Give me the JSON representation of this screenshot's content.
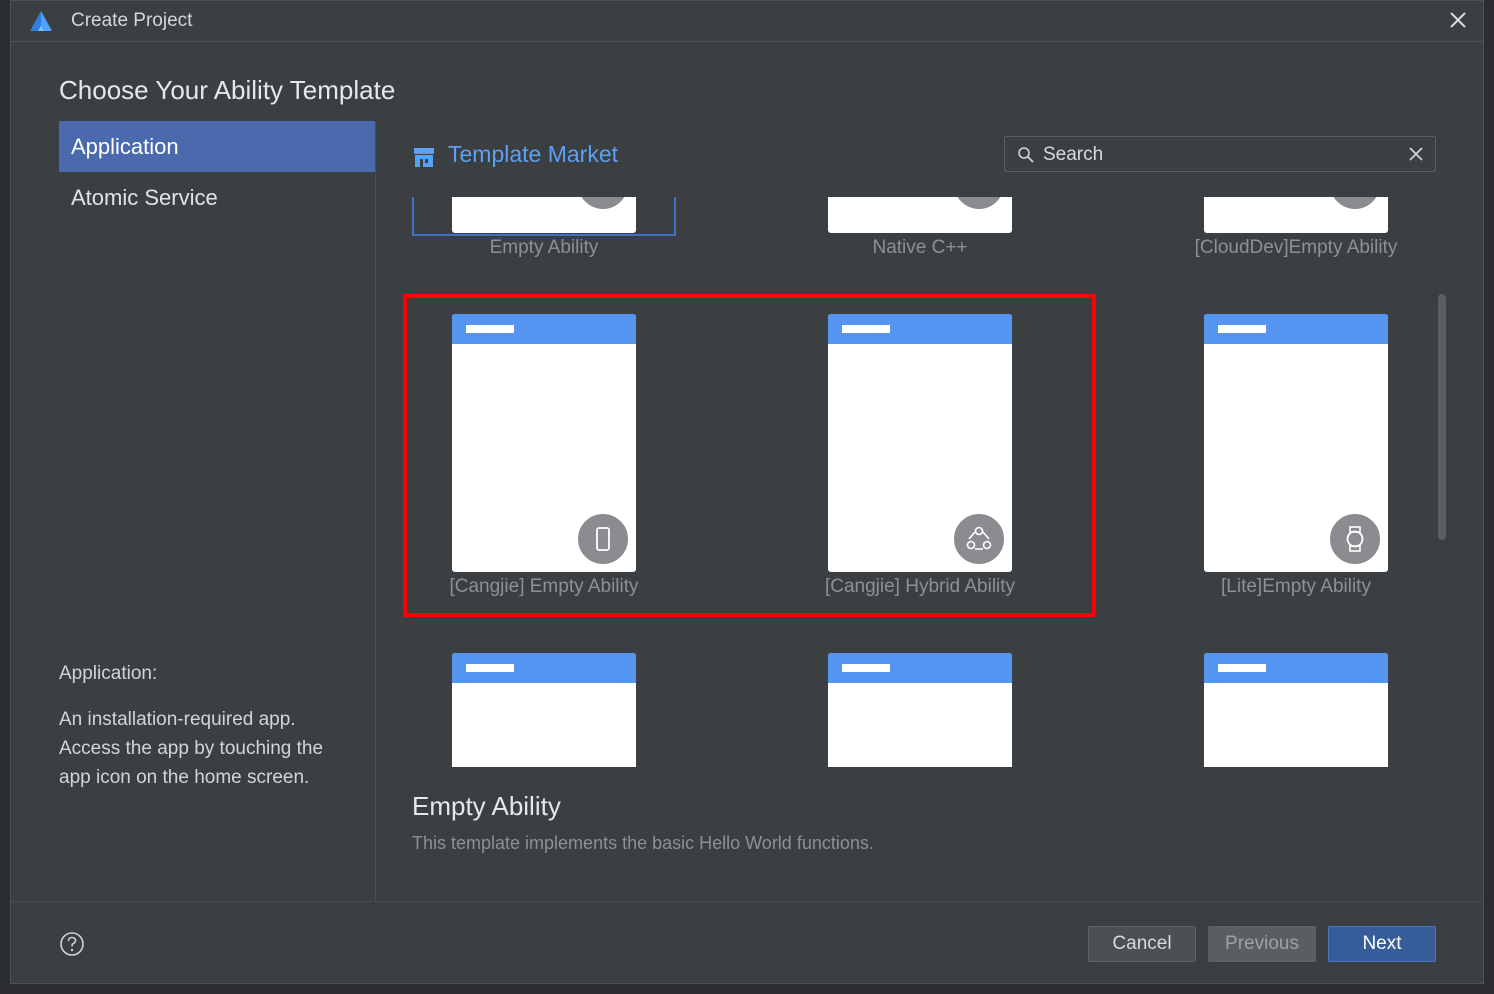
{
  "window": {
    "title": "Create Project"
  },
  "heading": "Choose Your Ability Template",
  "sidebar": {
    "items": [
      {
        "label": "Application",
        "active": true
      },
      {
        "label": "Atomic Service",
        "active": false
      }
    ],
    "description_title": "Application:",
    "description": "An installation-required app. Access the app by touching the app icon on the home screen."
  },
  "market": {
    "label": "Template Market",
    "icon": "store-icon"
  },
  "search": {
    "placeholder": "Search",
    "value": ""
  },
  "templates": {
    "row1": [
      {
        "label": "Empty Ability",
        "badge_icon": "multi-device-icon",
        "selected": true
      },
      {
        "label": "Native C++",
        "badge_icon": "multi-device-icon"
      },
      {
        "label": "[CloudDev]Empty Ability",
        "badge_icon": "phone-icon"
      }
    ],
    "row2": [
      {
        "label": "[Cangjie] Empty Ability",
        "badge_icon": "phone-icon"
      },
      {
        "label": "[Cangjie] Hybrid Ability",
        "badge_icon": "multi-device-icon"
      },
      {
        "label": "[Lite]Empty Ability",
        "badge_icon": "watch-icon"
      }
    ]
  },
  "detail": {
    "title": "Empty Ability",
    "description": "This template implements the basic Hello World functions."
  },
  "buttons": {
    "cancel": "Cancel",
    "previous": "Previous",
    "next": "Next"
  },
  "colors": {
    "accent": "#5594f0",
    "highlight": "#ff0000",
    "nav_active": "#4a6aad",
    "next_button": "#365d99"
  }
}
